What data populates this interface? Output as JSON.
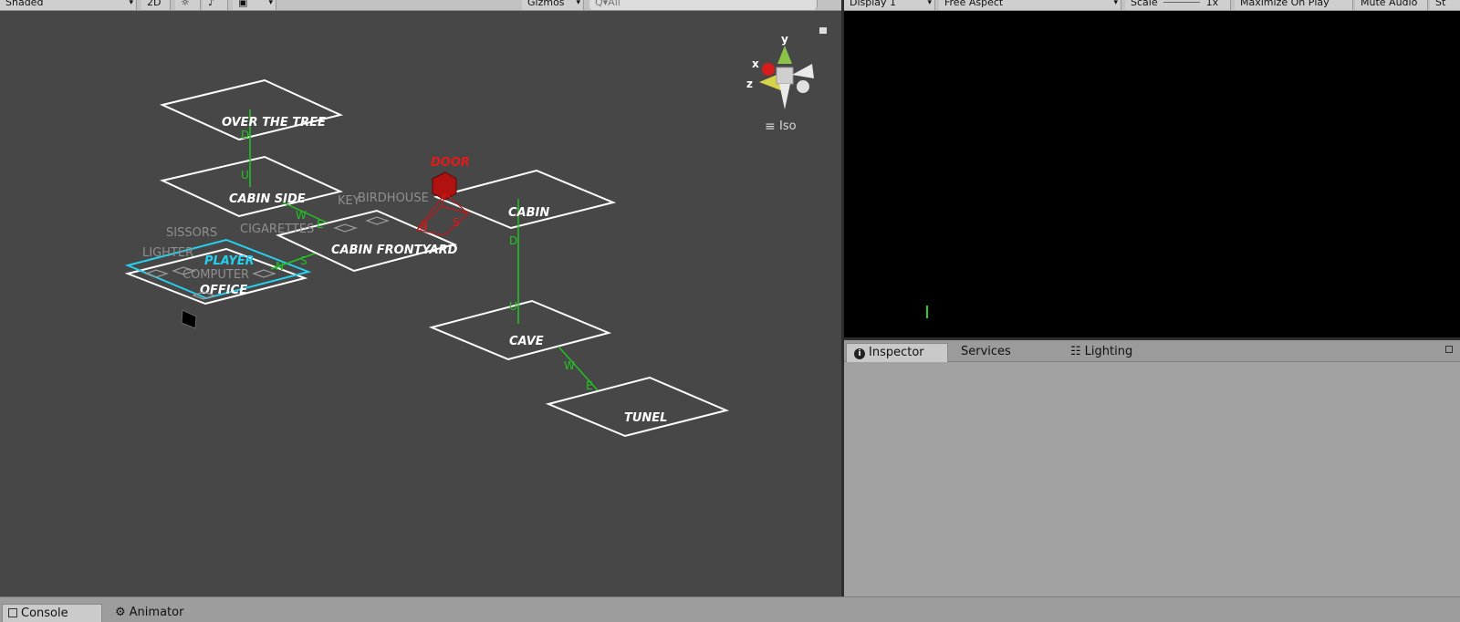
{
  "scene_toolbar": {
    "shading_mode": "Shaded",
    "mode_2d": "2D",
    "gizmos_label": "Gizmos",
    "search_placeholder": "Q▾All"
  },
  "game_toolbar": {
    "display": "Display 1",
    "aspect": "Free Aspect",
    "scale_label": "Scale",
    "scale_value": "1x",
    "maximize_label": "Maximize On Play",
    "mute_label": "Mute Audio",
    "stats_label": "St"
  },
  "gizmo": {
    "x_label": "x",
    "y_label": "y",
    "z_label": "z",
    "projection_label": "Iso",
    "colors": {
      "x": "#d81b1b",
      "y": "#8bc34a",
      "z": "#d6d24a"
    }
  },
  "scene": {
    "rooms": [
      {
        "name": "OVER THE TREE"
      },
      {
        "name": "CABIN SIDE"
      },
      {
        "name": "CABIN"
      },
      {
        "name": "CABIN FRONTYARD"
      },
      {
        "name": "OFFICE"
      },
      {
        "name": "CAVE"
      },
      {
        "name": "TUNEL"
      }
    ],
    "player_label": "PLAYER",
    "door_label": "DOOR",
    "items": [
      "KEY",
      "BIRDHOUSE",
      "SISSORS",
      "CIGARETTES",
      "LIGHTER",
      "COMPUTER"
    ],
    "exits": [
      "D",
      "U",
      "W",
      "E",
      "D",
      "U",
      "N",
      "S",
      "W",
      "E",
      "N",
      "S"
    ],
    "colors": {
      "room": "#ffffff",
      "player": "#27d0ee",
      "link": "#22c322",
      "door": "#e11b1b",
      "background": "#474747"
    }
  },
  "inspector": {
    "tabs": [
      "Inspector",
      "Services",
      "Lighting"
    ]
  },
  "bottom": {
    "tabs": [
      "Console",
      "Animator"
    ]
  }
}
